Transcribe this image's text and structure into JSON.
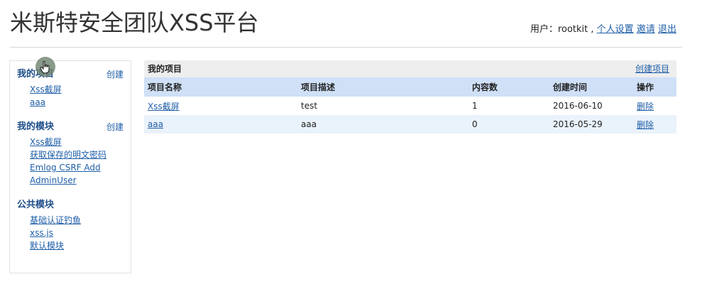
{
  "site": {
    "title": "米斯特安全团队XSS平台"
  },
  "userbar": {
    "prefix": "用户：rootkit ,",
    "settings": "个人设置",
    "invite": "邀请",
    "logout": "退出"
  },
  "sidebar": {
    "projects": {
      "heading": "我的项目",
      "create": "创建",
      "items": [
        "Xss截屏",
        "aaa"
      ]
    },
    "modules": {
      "heading": "我的模块",
      "create": "创建",
      "items": [
        "Xss截屏",
        "获取保存的明文密码",
        "Emlog CSRF Add",
        "AdminUser"
      ]
    },
    "public": {
      "heading": "公共模块",
      "items": [
        "基础认证钓鱼",
        "xss.js",
        "默认模块"
      ]
    }
  },
  "panel": {
    "title": "我的项目",
    "create_link": "创建项目",
    "columns": [
      "项目名称",
      "项目描述",
      "内容数",
      "创建时间",
      "操作"
    ],
    "rows": [
      {
        "name": "Xss截屏",
        "desc": "test",
        "count": "1",
        "date": "2016-06-10",
        "action": "删除"
      },
      {
        "name": "aaa",
        "desc": "aaa",
        "count": "0",
        "date": "2016-05-29",
        "action": "删除"
      }
    ]
  },
  "colors": {
    "link": "#1f5fa8",
    "heading": "#1f4f8a",
    "table_header": "#cfe0f7",
    "alt_row": "#eaf2fb"
  },
  "icons": {
    "cursor": "hand-pointer-icon"
  }
}
